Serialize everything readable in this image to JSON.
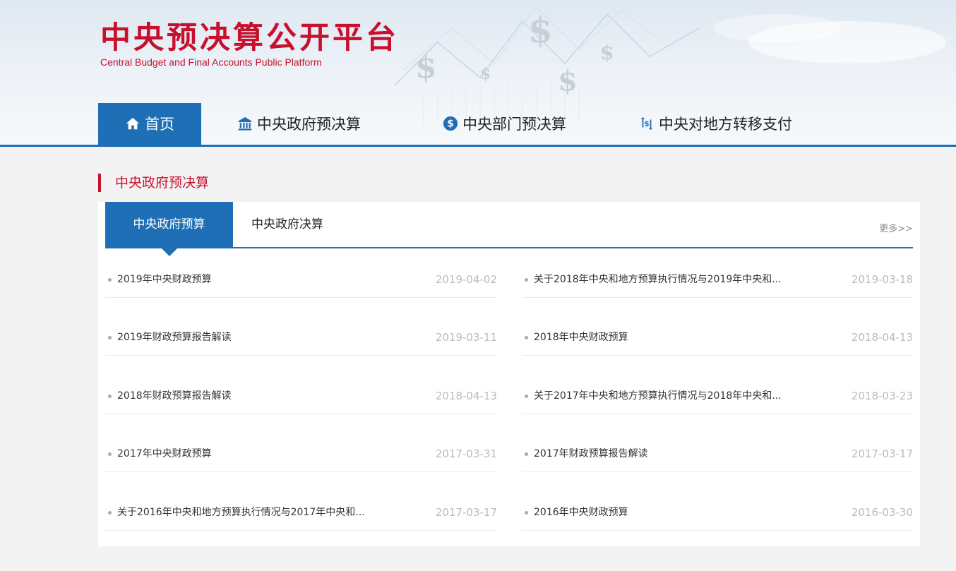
{
  "site": {
    "title_cn": "中央预决算公开平台",
    "title_en": "Central Budget and Final Accounts Public Platform"
  },
  "nav": {
    "items": [
      {
        "label": "首页",
        "icon": "home-icon"
      },
      {
        "label": "中央政府预决算",
        "icon": "bank-icon"
      },
      {
        "label": "中央部门预决算",
        "icon": "dollar-circle-icon"
      },
      {
        "label": "中央对地方转移支付",
        "icon": "transfer-icon"
      }
    ],
    "active_index": 0
  },
  "section": {
    "title": "中央政府预决算"
  },
  "tabs": {
    "items": [
      {
        "label": "中央政府预算"
      },
      {
        "label": "中央政府决算"
      }
    ],
    "active_index": 0,
    "more": "更多>>"
  },
  "articles": {
    "left": [
      {
        "title": "2019年中央财政预算",
        "date": "2019-04-02"
      },
      {
        "title": "2019年财政预算报告解读",
        "date": "2019-03-11"
      },
      {
        "title": "2018年财政预算报告解读",
        "date": "2018-04-13"
      },
      {
        "title": "2017年中央财政预算",
        "date": "2017-03-31"
      },
      {
        "title": "关于2016年中央和地方预算执行情况与2017年中央和...",
        "date": "2017-03-17"
      }
    ],
    "right": [
      {
        "title": "关于2018年中央和地方预算执行情况与2019年中央和...",
        "date": "2019-03-18"
      },
      {
        "title": "2018年中央财政预算",
        "date": "2018-04-13"
      },
      {
        "title": "关于2017年中央和地方预算执行情况与2018年中央和...",
        "date": "2018-03-23"
      },
      {
        "title": "2017年财政预算报告解读",
        "date": "2017-03-17"
      },
      {
        "title": "2016年中央财政预算",
        "date": "2016-03-30"
      }
    ]
  },
  "colors": {
    "brand_red": "#c8102e",
    "brand_blue": "#1f6fb6"
  }
}
